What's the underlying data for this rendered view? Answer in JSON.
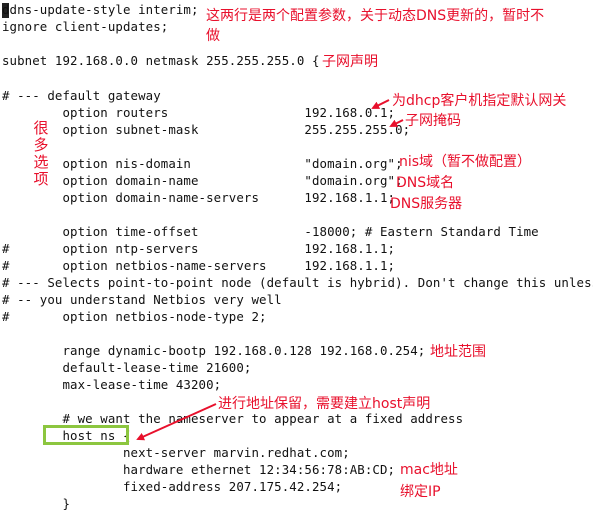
{
  "code": {
    "lines": [
      "ddns-update-style interim;",
      "ignore client-updates;",
      "",
      "subnet 192.168.0.0 netmask 255.255.255.0 {",
      "",
      "# --- default gateway",
      "        option routers                  192.168.0.1;",
      "        option subnet-mask              255.255.255.0;",
      "",
      "        option nis-domain               \"domain.org\";",
      "        option domain-name              \"domain.org\";",
      "        option domain-name-servers      192.168.1.1;",
      "",
      "        option time-offset              -18000; # Eastern Standard Time",
      "#       option ntp-servers              192.168.1.1;",
      "#       option netbios-name-servers     192.168.1.1;",
      "# --- Selects point-to-point node (default is hybrid). Don't change this unless",
      "# -- you understand Netbios very well",
      "#       option netbios-node-type 2;",
      "",
      "        range dynamic-bootp 192.168.0.128 192.168.0.254;",
      "        default-lease-time 21600;",
      "        max-lease-time 43200;",
      "",
      "        # we want the nameserver to appear at a fixed address",
      "        host ns {",
      "                next-server marvin.redhat.com;",
      "                hardware ethernet 12:34:56:78:AB:CD;",
      "                fixed-address 207.175.42.254;",
      "        }"
    ]
  },
  "annotations": {
    "config_params": "这两行是两个配置参数，关于动态DNS更新的，暂时不",
    "config_params_cont": "做",
    "subnet_decl": "子网声明",
    "default_gateway": "为dhcp客户机指定默认网关",
    "subnet_mask": "子网掩码",
    "many_options": "很多选项",
    "nis_domain": "nis域（暂不做配置）",
    "dns_domain": "DNS域名",
    "dns_server": "DNS服务器",
    "address_range": "地址范围",
    "reservation": "进行地址保留，需要建立host声明",
    "mac_address": "mac地址",
    "bind_ip": "绑定IP"
  },
  "colors": {
    "annotation": "#e8102c",
    "highlight_box": "#8cc63f",
    "code_text": "#111111",
    "background": "#ffffff"
  }
}
